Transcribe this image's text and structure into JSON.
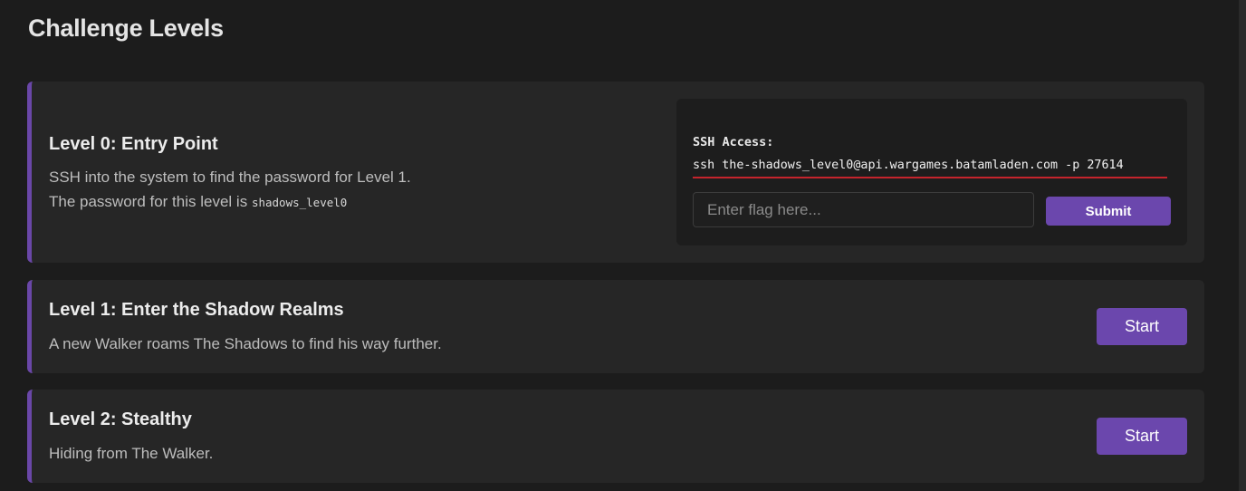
{
  "page": {
    "title": "Challenge Levels"
  },
  "levels": [
    {
      "title": "Level 0: Entry Point",
      "description": "SSH into the system to find the password for Level 1.",
      "password_prefix": "The password for this level is",
      "password": "shadows_level0",
      "ssh": {
        "label": "SSH Access:",
        "command": "ssh the-shadows_level0@api.wargames.batamladen.com -p 27614"
      },
      "flag_input": {
        "value": "",
        "placeholder": "Enter flag here..."
      },
      "submit_label": "Submit"
    },
    {
      "title": "Level 1: Enter the Shadow Realms",
      "description": "A new Walker roams The Shadows to find his way further.",
      "start_label": "Start"
    },
    {
      "title": "Level 2: Stealthy",
      "description": "Hiding from The Walker.",
      "start_label": "Start"
    }
  ],
  "colors": {
    "accent": "#6b47ad",
    "card_border": "#6a47a8",
    "ssh_underline": "#c4242c",
    "background": "#1c1c1c",
    "card_background": "#262626"
  }
}
